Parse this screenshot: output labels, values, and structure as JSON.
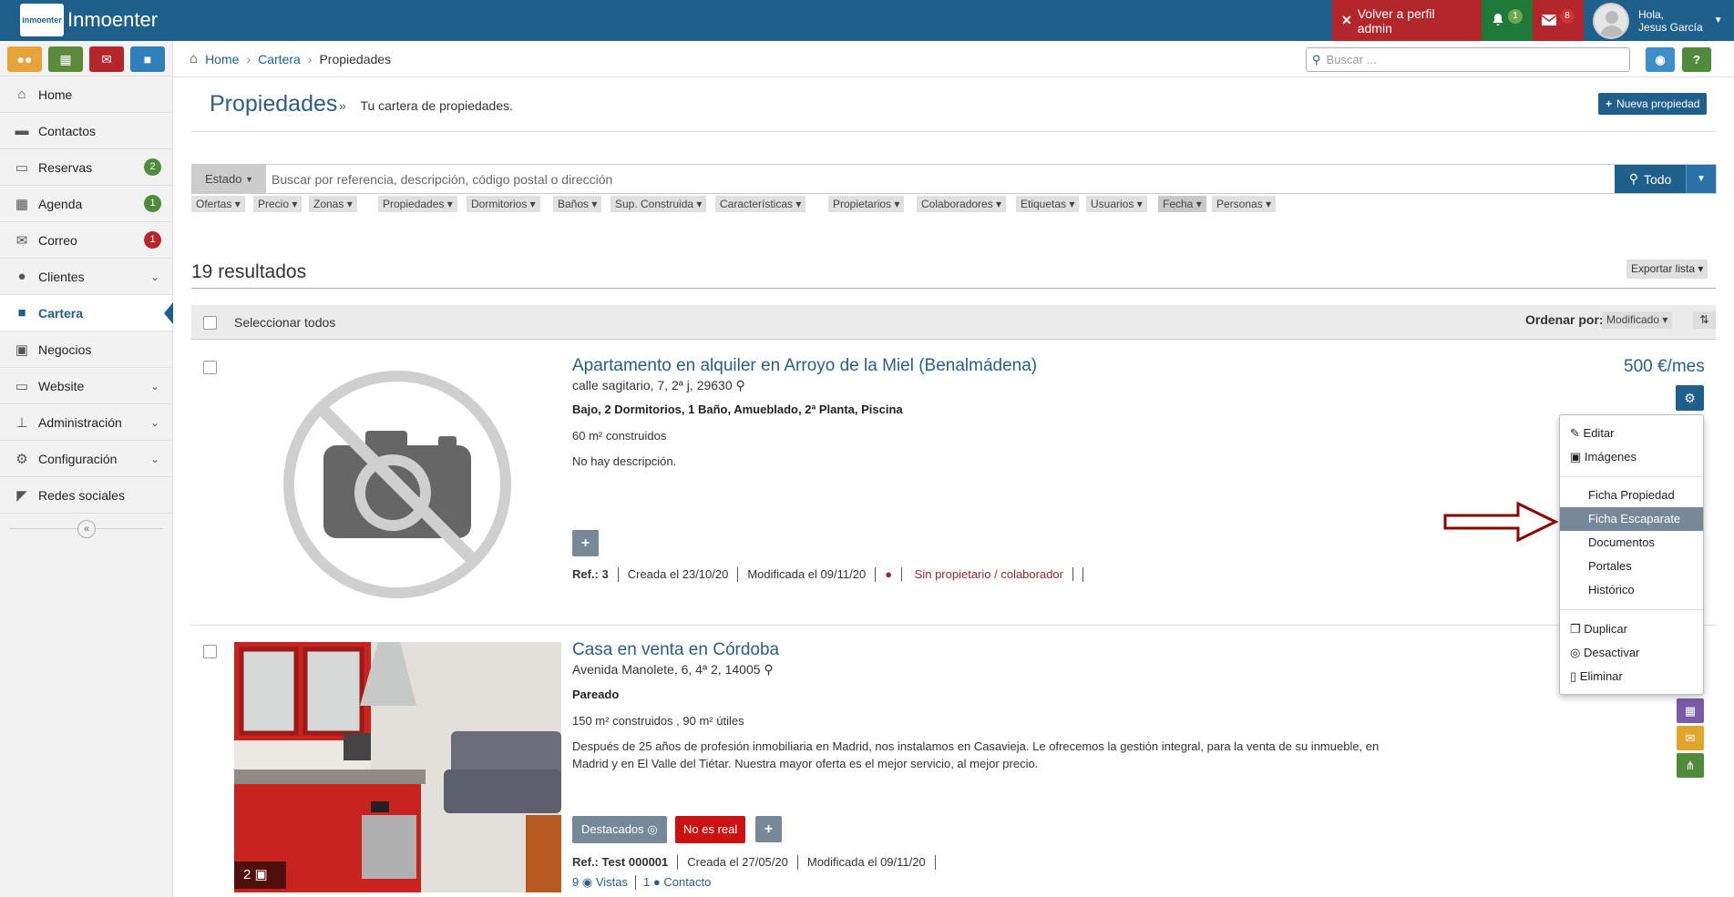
{
  "app": {
    "title": "Inmoenter",
    "logo_text": "inmoenter"
  },
  "topbar": {
    "admin_label": "Volver a perfil admin",
    "bell_count": "1",
    "mail_count": "8",
    "user_greeting": "Hola,",
    "user_name": "Jesus García"
  },
  "sidebar": {
    "items": [
      {
        "label": "Home",
        "icon": "home-icon"
      },
      {
        "label": "Contactos",
        "icon": "comment-icon"
      },
      {
        "label": "Reservas",
        "icon": "bed-icon",
        "badge": "2"
      },
      {
        "label": "Agenda",
        "icon": "calendar-icon",
        "badge": "1"
      },
      {
        "label": "Correo",
        "icon": "envelope-icon",
        "badge": "1"
      },
      {
        "label": "Clientes",
        "icon": "users-icon"
      },
      {
        "label": "Cartera",
        "icon": "briefcase-icon"
      },
      {
        "label": "Negocios",
        "icon": "money-icon"
      },
      {
        "label": "Website",
        "icon": "monitor-icon"
      },
      {
        "label": "Administración",
        "icon": "sitemap-icon"
      },
      {
        "label": "Configuración",
        "icon": "cogs-icon"
      },
      {
        "label": "Redes sociales",
        "icon": "share-icon"
      }
    ]
  },
  "breadcrumb": {
    "home": "Home",
    "cartera": "Cartera",
    "current": "Propiedades"
  },
  "search": {
    "placeholder": "Buscar ..."
  },
  "page": {
    "title": "Propiedades",
    "separator": "»",
    "subtitle": "Tu cartera de propiedades.",
    "new_button": "Nueva propiedad"
  },
  "filters": {
    "estado": "Estado",
    "placeholder": "Buscar por referencia, descripción, código postal o dirección",
    "todo": "Todo",
    "chips": [
      "Ofertas",
      "Precio",
      "Zonas",
      "Propiedades",
      "Dormitorios",
      "Baños",
      "Sup. Construida",
      "Características",
      "Propietarios",
      "Colaboradores",
      "Etiquetas",
      "Usuarios",
      "Fecha",
      "Personas"
    ]
  },
  "results": {
    "count_label": "19 resultados",
    "export": "Exportar lista",
    "select_all": "Seleccionar todos",
    "order_label": "Ordenar por:",
    "order_value": "Modificado"
  },
  "listing1": {
    "title": "Apartamento en alquiler en Arroyo de la Miel (Benalmádena)",
    "address": "calle sagitario, 7, 2ª j, 29630",
    "features": "Bajo, 2 Dormitorios, 1 Baño, Amueblado, 2ª Planta, Piscina",
    "area": "60 m² construidos",
    "description": "No hay descripción.",
    "price": "500 €/mes",
    "ref_label": "Ref.: 3",
    "created": "Creada el 23/10/20",
    "modified": "Modificada el 09/11/20",
    "warning": "Sin propietario / colaborador"
  },
  "listing2": {
    "title": "Casa en venta en Córdoba",
    "address": "Avenida Manolete, 6, 4ª 2, 14005",
    "type": "Pareado",
    "area": "150 m² construidos , 90 m² útiles",
    "description_line1": "Después de 25 años de profesión inmobiliaria en Madrid, nos instalamos en Casavieja. Le ofrecemos la gestión integral, para la venta de su inmueble, en",
    "description_line2": "Madrid y en El Valle del Tiétar. Nuestra mayor oferta es el mejor servicio, al mejor precio.",
    "tag_featured": "Destacados",
    "tag_not_real": "No es real",
    "ref_label": "Ref.: Test 000001",
    "created": "Creada el 27/05/20",
    "modified": "Modificada el 09/11/20",
    "views_count": "9",
    "views_label": "Vistas",
    "contact_count": "1",
    "contact_label": "Contacto",
    "photo_count": "2"
  },
  "dropdown": {
    "items": [
      "Editar",
      "Imágenes",
      "Ficha Propiedad",
      "Ficha Escaparate",
      "Documentos",
      "Portales",
      "Histórico",
      "Duplicar",
      "Desactivar",
      "Eliminar"
    ],
    "highlighted": "Ficha Escaparate"
  },
  "colors": {
    "primary": "#1f5f8b",
    "danger": "#b3262b",
    "success": "#4f8b3a",
    "arrow": "#8b0000"
  }
}
